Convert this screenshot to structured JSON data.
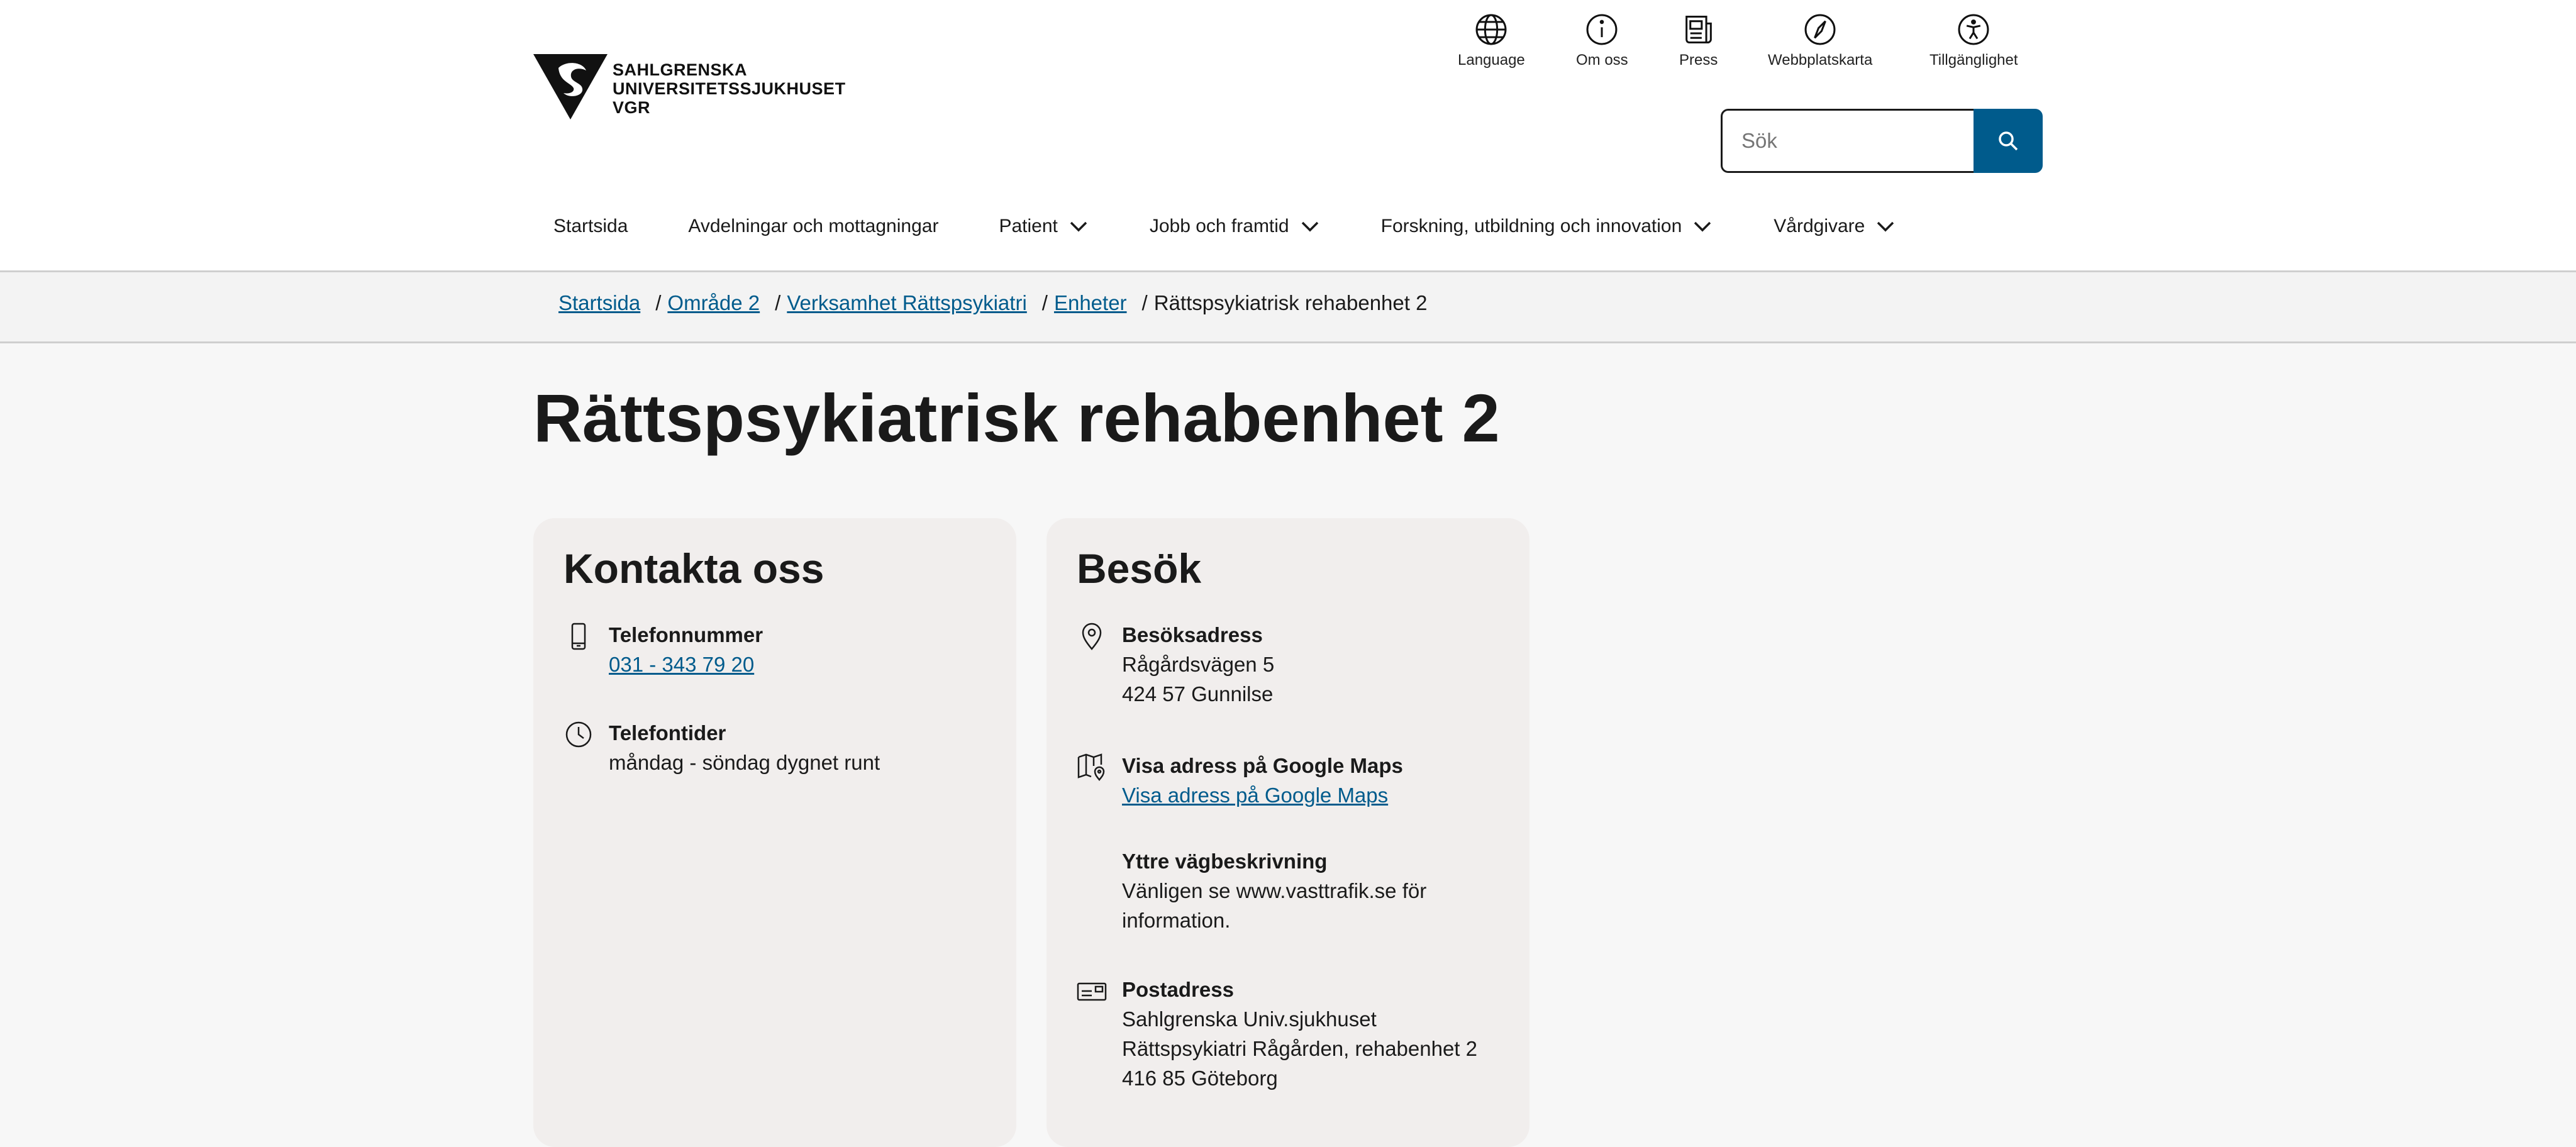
{
  "header": {
    "logo": {
      "line1": "SAHLGRENSKA",
      "line2": "UNIVERSITETSSJUKHUSET",
      "line3": "VGR",
      "icon": "sahlgrenska-logo"
    },
    "utility_links": [
      {
        "label": "Language",
        "icon": "globe-icon"
      },
      {
        "label": "Om oss",
        "icon": "info-icon"
      },
      {
        "label": "Press",
        "icon": "newspaper-icon"
      },
      {
        "label": "Webbplatskarta",
        "icon": "compass-icon"
      },
      {
        "label": "Tillgänglighet",
        "icon": "accessibility-icon"
      }
    ],
    "search": {
      "placeholder": "Sök",
      "value": ""
    }
  },
  "nav": {
    "items": [
      {
        "label": "Startsida",
        "has_dropdown": false
      },
      {
        "label": "Avdelningar och mottagningar",
        "has_dropdown": false
      },
      {
        "label": "Patient",
        "has_dropdown": true
      },
      {
        "label": "Jobb och framtid",
        "has_dropdown": true
      },
      {
        "label": "Forskning, utbildning och innovation",
        "has_dropdown": true
      },
      {
        "label": "Vårdgivare",
        "has_dropdown": true
      }
    ]
  },
  "breadcrumb": {
    "items": [
      "Startsida",
      "Område 2",
      "Verksamhet Rättspsykiatri",
      "Enheter"
    ],
    "current": "Rättspsykiatrisk rehabenhet 2"
  },
  "page": {
    "title": "Rättspsykiatrisk rehabenhet 2"
  },
  "contact": {
    "title": "Kontakta oss",
    "phone_label": "Telefonnummer",
    "phone_value": "031 - 343 79 20",
    "hours_label": "Telefontider",
    "hours_value": "måndag - söndag dygnet runt"
  },
  "visit": {
    "title": "Besök",
    "address_label": "Besöksadress",
    "address_line1": "Rågårdsvägen 5",
    "address_line2": "424 57 Gunnilse",
    "maps_label": "Visa adress på Google Maps",
    "maps_link": "Visa adress på Google Maps",
    "directions_label": "Yttre vägbeskrivning",
    "directions_line1": "Vänligen se www.vasttrafik.se för",
    "directions_line2": "information.",
    "postal_label": "Postadress",
    "postal_line1": "Sahlgrenska Univ.sjukhuset",
    "postal_line2": "Rättspsykiatri Rågården, rehabenhet 2",
    "postal_line3": "416 85 Göteborg"
  },
  "colors": {
    "accent": "#005b8c",
    "page_bg": "#f7f7f7",
    "card_bg": "#f1eeed"
  }
}
